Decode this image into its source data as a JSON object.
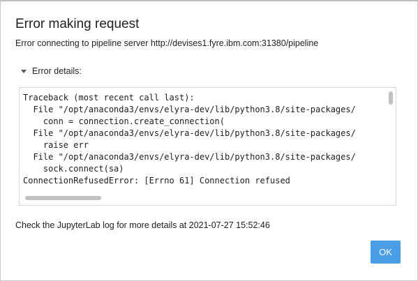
{
  "dialog": {
    "title": "Error making request",
    "message": "Error connecting to pipeline server http://devises1.fyre.ibm.com:31380/pipeline",
    "details_label": "Error details:",
    "traceback_lines": [
      "Traceback (most recent call last):",
      "  File \"/opt/anaconda3/envs/elyra-dev/lib/python3.8/site-packages/",
      "    conn = connection.create_connection(",
      "  File \"/opt/anaconda3/envs/elyra-dev/lib/python3.8/site-packages/",
      "    raise err",
      "  File \"/opt/anaconda3/envs/elyra-dev/lib/python3.8/site-packages/",
      "    sock.connect(sa)",
      "ConnectionRefusedError: [Errno 61] Connection refused"
    ],
    "footer_note": "Check the JupyterLab log for more details at 2021-07-27 15:52:46",
    "ok_label": "OK"
  },
  "colors": {
    "accent": "#4a9ee6",
    "text": "#212121",
    "border": "#d6d6d6",
    "scrollbar_thumb": "#c1c1c1"
  },
  "icons": {
    "details_toggle": "caret-down-icon"
  }
}
